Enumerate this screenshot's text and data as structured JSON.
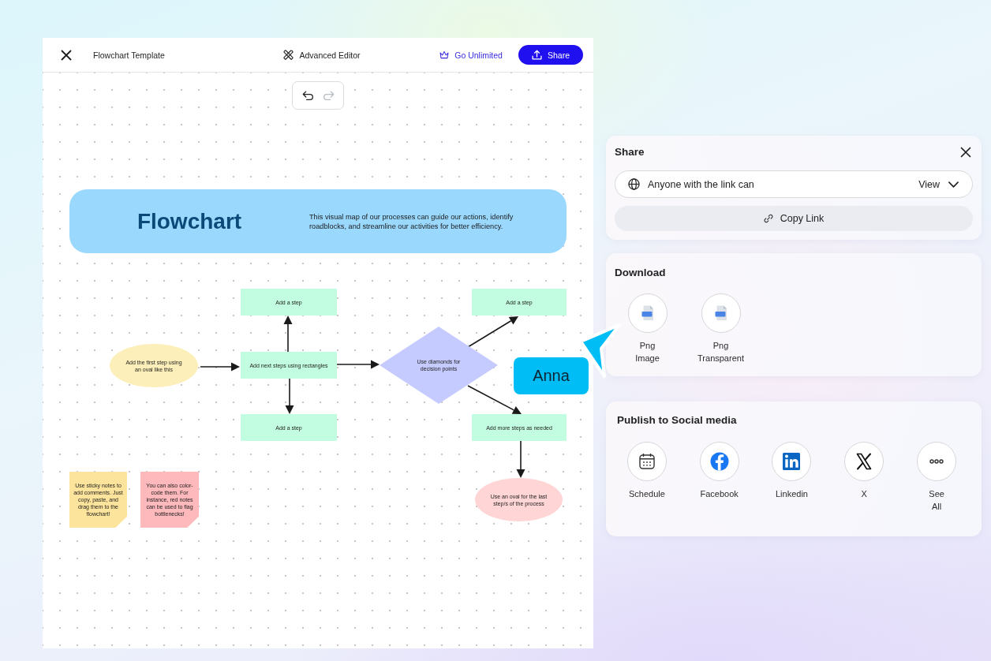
{
  "editor": {
    "title": "Flowchart Template",
    "advanced_editor": "Advanced Editor",
    "upgrade_link": "Go Unlimited",
    "share_button": "Share",
    "history": [
      {
        "kind": "undo",
        "disabled": false
      },
      {
        "kind": "redo",
        "disabled": true
      }
    ]
  },
  "canvas": {
    "banner": {
      "title": "Flowchart",
      "description": "This visual map of our processes can guide our actions, identify roadblocks, and streamline our activities for better efficiency."
    },
    "nodes": [
      {
        "kind": "rectangle",
        "text": "Add a step",
        "color": "#c3fde1"
      },
      {
        "kind": "rectangle",
        "text": "Add a step",
        "color": "#c3fde1"
      },
      {
        "kind": "oval",
        "text": "Add the first step using an oval like this",
        "color": "#fdefb9"
      },
      {
        "kind": "rectangle",
        "text": "Add next steps using rectangles",
        "color": "#c3fde1"
      },
      {
        "kind": "diamond",
        "text": "Use diamonds for decision points",
        "color": "#c5cbfe"
      },
      {
        "kind": "rectangle",
        "text": "Add a step",
        "color": "#c3fde1"
      },
      {
        "kind": "rectangle",
        "text": "Add more steps as needed",
        "color": "#c3fde1"
      },
      {
        "kind": "oval",
        "text": "Use an oval for the last step/s of the process",
        "color": "#ffd5d6"
      }
    ],
    "sticky_notes": [
      {
        "text": "Use sticky notes to add comments. Just copy, paste, and drag them to the flowchart!",
        "color": "#fde49c"
      },
      {
        "text": "You can also color-code them. For instance, red notes can be used to flag bottlenecks!",
        "color": "#fdb9bc"
      }
    ],
    "collaborator": {
      "name": "Anna",
      "color": "#00bef5"
    }
  },
  "share_panel": {
    "title": "Share",
    "access_label": "Anyone with the link can",
    "permission": "View",
    "copy_link": "Copy Link"
  },
  "download_panel": {
    "title": "Download",
    "options": [
      {
        "label": "Png Image"
      },
      {
        "label": "Png Transparent"
      }
    ]
  },
  "social_panel": {
    "title": "Publish to Social media",
    "options": [
      {
        "kind": "schedule",
        "label": "Schedule"
      },
      {
        "kind": "facebook",
        "label": "Facebook"
      },
      {
        "kind": "linkedin",
        "label": "Linkedin"
      },
      {
        "kind": "x",
        "label": "X"
      },
      {
        "kind": "see_all",
        "label": "See All"
      }
    ]
  }
}
